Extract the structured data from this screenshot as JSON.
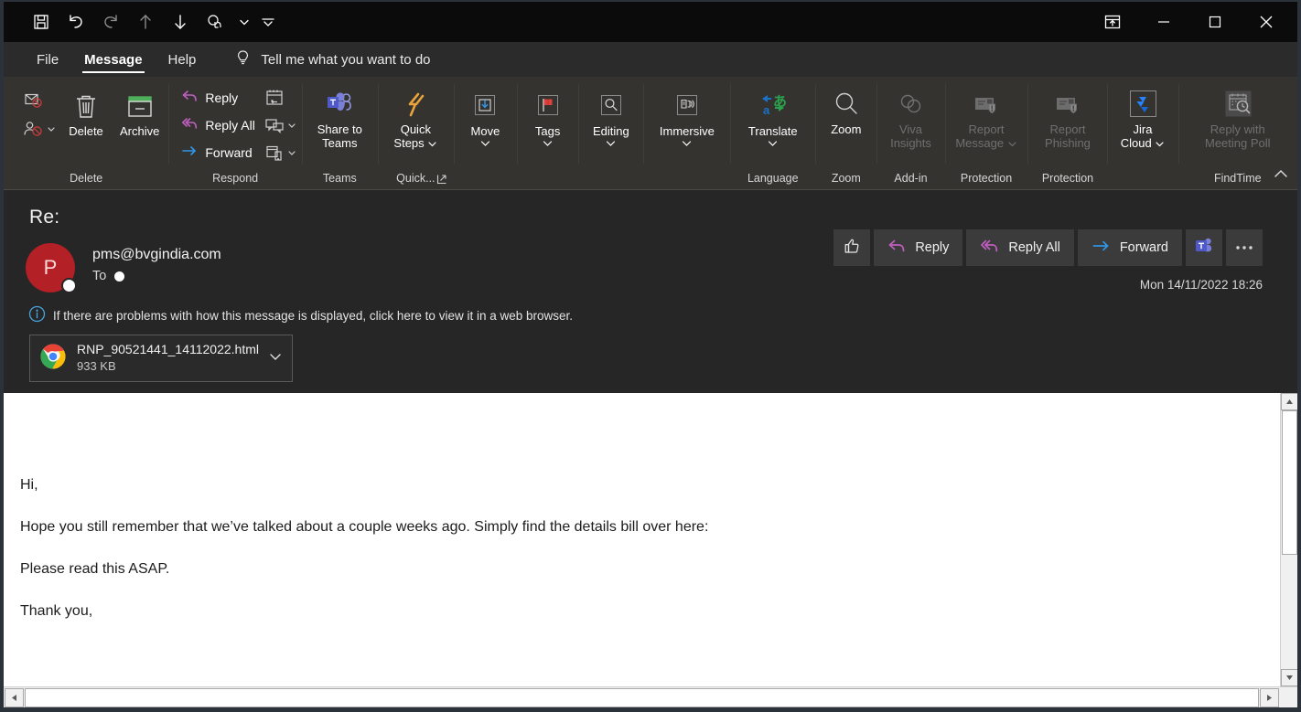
{
  "window": {
    "quick_access": [
      {
        "name": "save-icon",
        "label": "Save"
      },
      {
        "name": "undo-icon",
        "label": "Undo"
      },
      {
        "name": "redo-icon",
        "label": "Redo"
      },
      {
        "name": "previous-item-icon",
        "label": "Previous Item"
      },
      {
        "name": "next-item-icon",
        "label": "Next Item"
      },
      {
        "name": "touch-mode-icon",
        "label": "Touch/Mouse Mode"
      },
      {
        "name": "touch-mode-caret-icon",
        "label": "Touch Mode Options"
      },
      {
        "name": "customize-quick-access-toolbar-icon",
        "label": "Customize Quick Access Toolbar"
      }
    ],
    "controls": [
      {
        "name": "ribbon-display-options-button",
        "label": "Ribbon Display Options"
      },
      {
        "name": "minimize-button",
        "label": "Minimize"
      },
      {
        "name": "maximize-button",
        "label": "Maximize"
      },
      {
        "name": "close-button",
        "label": "Close"
      }
    ]
  },
  "tabs": {
    "items": [
      {
        "label": "File",
        "active": false
      },
      {
        "label": "Message",
        "active": true
      },
      {
        "label": "Help",
        "active": false
      }
    ],
    "tell_me": "Tell me what you want to do"
  },
  "ribbon": {
    "collapse_label": "Collapse the Ribbon",
    "groups": [
      {
        "label": "Delete",
        "icon_buttons": [
          {
            "label": "Ignore",
            "name": "ignore-icon"
          },
          {
            "label": "Block",
            "name": "block-sender-icon"
          }
        ],
        "buttons": [
          {
            "label": "Delete",
            "name": "delete-button"
          },
          {
            "label": "Archive",
            "name": "archive-button"
          }
        ]
      },
      {
        "label": "Respond",
        "buttons": [
          {
            "label": "Reply",
            "name": "reply-button"
          },
          {
            "label": "Reply All",
            "name": "reply-all-button"
          },
          {
            "label": "Forward",
            "name": "forward-button"
          }
        ],
        "icon_buttons": [
          {
            "label": "Meeting",
            "name": "meeting-icon"
          },
          {
            "label": "More Respond Options",
            "name": "reply-with-im-icon"
          },
          {
            "label": "More Actions",
            "name": "more-respond-icon"
          }
        ]
      },
      {
        "label": "Teams",
        "buttons": [
          {
            "label1": "Share to",
            "label2": "Teams",
            "name": "share-to-teams-button"
          }
        ]
      },
      {
        "label": "Quick...",
        "has_launcher": true,
        "buttons": [
          {
            "label1": "Quick",
            "label2": "Steps",
            "name": "quick-steps-button"
          }
        ]
      },
      {
        "label": "",
        "buttons": [
          {
            "label1": "Move",
            "label2": "",
            "name": "move-button"
          }
        ]
      },
      {
        "label": "",
        "buttons": [
          {
            "label1": "Tags",
            "label2": "",
            "name": "tags-button"
          }
        ]
      },
      {
        "label": "",
        "buttons": [
          {
            "label1": "Editing",
            "label2": "",
            "name": "editing-button"
          }
        ]
      },
      {
        "label": "",
        "buttons": [
          {
            "label1": "Immersive",
            "label2": "",
            "name": "immersive-button"
          }
        ]
      },
      {
        "label": "Language",
        "buttons": [
          {
            "label1": "Translate",
            "label2": "",
            "name": "translate-button"
          }
        ]
      },
      {
        "label": "Zoom",
        "buttons": [
          {
            "label1": "Zoom",
            "label2": "",
            "name": "zoom-button"
          }
        ]
      },
      {
        "label": "Add-in",
        "disabled": true,
        "buttons": [
          {
            "label1": "Viva",
            "label2": "Insights",
            "name": "viva-insights-button"
          }
        ]
      },
      {
        "label": "Protection",
        "disabled": true,
        "buttons": [
          {
            "label1": "Report",
            "label2": "Message",
            "name": "report-message-button"
          }
        ]
      },
      {
        "label": "Protection",
        "disabled": true,
        "buttons": [
          {
            "label1": "Report",
            "label2": "Phishing",
            "name": "report-phishing-button"
          }
        ]
      },
      {
        "label": "",
        "buttons": [
          {
            "label1": "Jira",
            "label2": "Cloud",
            "name": "jira-cloud-button"
          }
        ]
      },
      {
        "label": "FindTime",
        "disabled": true,
        "buttons": [
          {
            "label1": "Reply with",
            "label2": "Meeting Poll",
            "name": "reply-with-meeting-poll-button"
          }
        ]
      }
    ],
    "labels": {
      "delete": "Delete",
      "respond": "Respond",
      "teams": "Teams",
      "quick": "Quick...",
      "language": "Language",
      "zoom": "Zoom",
      "addin": "Add-in",
      "protection1": "Protection",
      "protection2": "Protection",
      "findtime": "FindTime"
    },
    "items": {
      "delete": "Delete",
      "archive": "Archive",
      "reply": "Reply",
      "reply_all": "Reply All",
      "forward": "Forward",
      "share_to_teams_1": "Share to",
      "share_to_teams_2": "Teams",
      "quick_steps_1": "Quick",
      "quick_steps_2": "Steps",
      "move": "Move",
      "tags": "Tags",
      "editing": "Editing",
      "immersive": "Immersive",
      "translate": "Translate",
      "zoom": "Zoom",
      "viva_1": "Viva",
      "viva_2": "Insights",
      "report_message_1": "Report",
      "report_message_2": "Message",
      "report_phishing_1": "Report",
      "report_phishing_2": "Phishing",
      "jira_1": "Jira",
      "jira_2": "Cloud",
      "meeting_poll_1": "Reply with",
      "meeting_poll_2": "Meeting Poll"
    }
  },
  "message": {
    "subject": "Re:",
    "sender_initial": "P",
    "sender_address": "pms@bvgindia.com",
    "to_label": "To",
    "info_bar": "If there are problems with how this message is displayed, click here to view it in a web browser.",
    "timestamp": "Mon 14/11/2022 18:26",
    "attachment": {
      "name": "RNP_90521441_14112022.html",
      "size": "933 KB",
      "icon": "chrome-icon"
    },
    "actions": [
      {
        "label": "",
        "name": "like-button",
        "icon": "thumbs-up-icon"
      },
      {
        "label": "Reply",
        "name": "header-reply-button",
        "icon": "reply-arrow-icon"
      },
      {
        "label": "Reply All",
        "name": "header-reply-all-button",
        "icon": "reply-all-arrow-icon"
      },
      {
        "label": "Forward",
        "name": "header-forward-button",
        "icon": "forward-arrow-icon"
      },
      {
        "label": "",
        "name": "teams-share-button",
        "icon": "teams-icon"
      },
      {
        "label": "",
        "name": "more-options-button",
        "icon": "ellipsis-icon"
      }
    ],
    "action_labels": {
      "reply": "Reply",
      "reply_all": "Reply All",
      "forward": "Forward"
    },
    "body": [
      "Hi,",
      "Hope you still remember that we’ve talked about a couple weeks ago. Simply find the details bill over here:",
      "Please read this ASAP.",
      "Thank you,"
    ]
  },
  "colors": {
    "titlebar_bg": "#0b0b0b",
    "tabbar_bg": "#2b2b2b",
    "ribbon_bg": "#343330",
    "header_bg": "#262626",
    "body_bg": "#ffffff",
    "avatar_bg": "#b32025",
    "accent_reply": "#c05fc0",
    "accent_forward": "#2f96e8",
    "window_border": "#2b323a"
  }
}
